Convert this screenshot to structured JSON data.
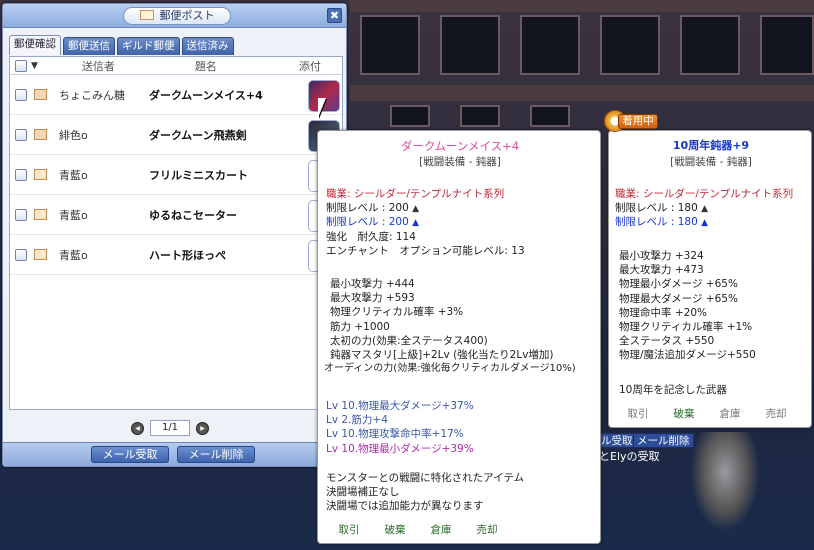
{
  "mail_window": {
    "title": "郵便ポスト",
    "close_label": "✖",
    "tabs": [
      "郵便確認",
      "郵便送信",
      "ギルド郵便",
      "送信済み"
    ],
    "columns": {
      "sender": "送信者",
      "subject": "題名",
      "attachment": "添付"
    },
    "rows": [
      {
        "sender": "ちょこみん糖",
        "subject": "ダークムーンメイス+4"
      },
      {
        "sender": "緋色o",
        "subject": "ダークムーン飛燕剣"
      },
      {
        "sender": "青藍o",
        "subject": "フリルミニスカート"
      },
      {
        "sender": "青藍o",
        "subject": "ゆるねこセーター"
      },
      {
        "sender": "青藍o",
        "subject": "ハート形ほっぺ"
      }
    ],
    "page": "1/1",
    "receive_button": "メール受取",
    "delete_button": "メール削除"
  },
  "tooltip_item": {
    "name": "ダークムーンメイス+4",
    "category": "[戦闘装備 - 鈍器]",
    "job": "職業: シールダー/テンプルナイト系列",
    "req_level_1": "制限レベル : 200",
    "req_level_2": "制限レベル : 200",
    "durability": "強化　耐久度: 114",
    "enchant": "エンチャント　オプション可能レベル: 13",
    "stats": [
      "最小攻撃力 +444",
      "最大攻撃力 +593",
      "物理クリティカル確率 +3%",
      "筋力 +1000",
      "太初の力(効果:全ステータス400)",
      "鈍器マスタリ[上級]+2Lv (強化当たり2Lv増加)"
    ],
    "odin": "オーディンの力(効果:強化毎クリティカルダメージ10%)",
    "lv_stats": [
      "Lv 10.物理最大ダメージ+37%",
      "Lv 2.筋力+4",
      "Lv 10.物理攻撃命中率+17%",
      "Lv 10.物理最小ダメージ+39%"
    ],
    "desc": [
      "モンスターとの戦闘に特化されたアイテム",
      "決闘場補正なし",
      "決闘場では追加能力が異なります"
    ],
    "actions": [
      "取引",
      "破棄",
      "倉庫",
      "売却"
    ]
  },
  "tooltip_equipped": {
    "badge": "着用中",
    "name": "10周年鈍器+9",
    "category": "[戦闘装備 - 鈍器]",
    "job": "職業: シールダー/テンプルナイト系列",
    "req_level_1": "制限レベル : 180",
    "req_level_2": "制限レベル : 180",
    "stats": [
      "最小攻撃力 +324",
      "最大攻撃力 +473",
      "物理最小ダメージ +65%",
      "物理最大ダメージ +65%",
      "物理命中率 +20%",
      "物理クリティカル確率 +1%",
      "全ステータス +550",
      "物理/魔法追加ダメージ+550"
    ],
    "desc": "10周年を記念した武器",
    "actions": [
      "取引",
      "破棄",
      "倉庫",
      "売却"
    ]
  },
  "background_ui": {
    "receive": "ル受取",
    "delete": "メール削除",
    "text": "とElyの受取"
  }
}
